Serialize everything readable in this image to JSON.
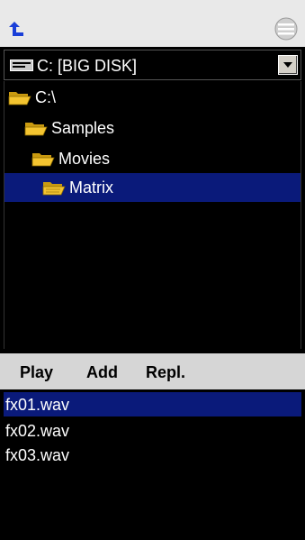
{
  "toolbar": {
    "up_icon": "up-arrow-icon",
    "menu_icon": "menu-icon"
  },
  "drive": {
    "label": "C: [BIG DISK]",
    "icon": "hard-drive-icon",
    "dropdown_icon": "chevron-down-icon"
  },
  "tree": {
    "items": [
      {
        "label": "C:\\",
        "icon": "folder-open-icon",
        "selected": false
      },
      {
        "label": "Samples",
        "icon": "folder-open-icon",
        "selected": false
      },
      {
        "label": "Movies",
        "icon": "folder-open-icon",
        "selected": false
      },
      {
        "label": "Matrix",
        "icon": "folder-open-icon",
        "selected": true
      }
    ]
  },
  "actions": {
    "play_label": "Play",
    "add_label": "Add",
    "replace_label": "Repl."
  },
  "files": {
    "items": [
      {
        "label": "fx01.wav",
        "selected": true
      },
      {
        "label": "fx02.wav",
        "selected": false
      },
      {
        "label": "fx03.wav",
        "selected": false
      }
    ]
  },
  "colors": {
    "background": "#000000",
    "selection": "#0a1a7a",
    "folder": "#f4c430",
    "toolbar": "#e9e9e9",
    "action_bar": "#d6d6d6",
    "up_arrow": "#1a3fd8"
  }
}
